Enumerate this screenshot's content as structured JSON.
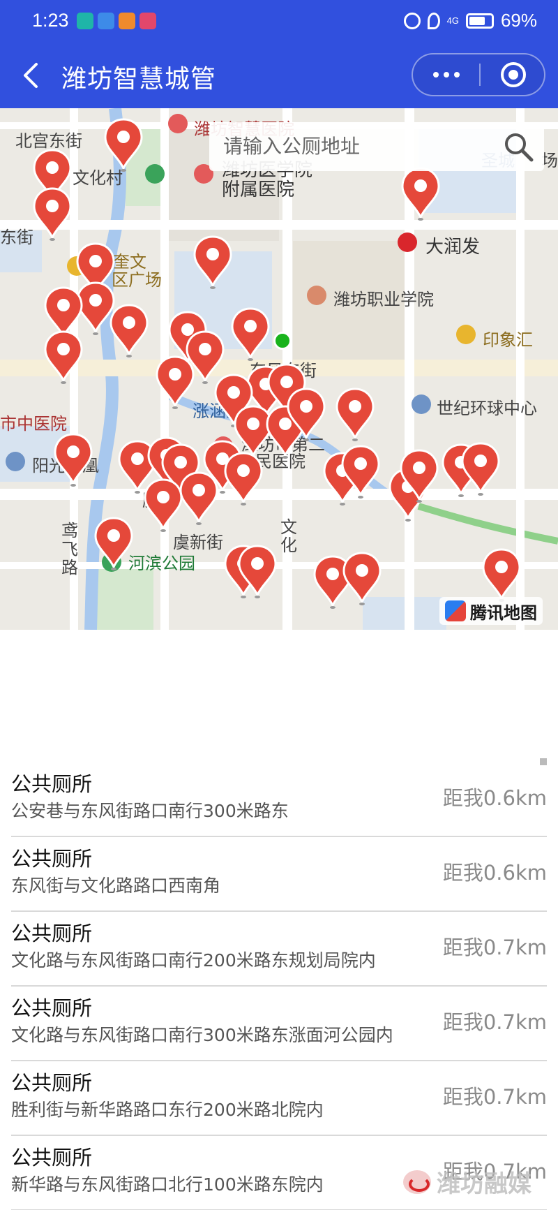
{
  "status_bar": {
    "time": "1:23",
    "battery": "69%",
    "network": "4G"
  },
  "header": {
    "title": "潍坊智慧城管"
  },
  "colors": {
    "header_bg": "#3150de",
    "pin_red": "#e5483a",
    "current_location": "#19b31c"
  },
  "search": {
    "placeholder": "请输入公厕地址"
  },
  "map": {
    "attribution": "腾讯地图",
    "labels": {
      "beigong": "北宫东街",
      "weifang_zhong": "潍坊智慧医院",
      "wenhuacun": "文化村",
      "yixueyuan1": "潍坊医学院",
      "yixueyuan2": "附属医院",
      "dongjie": "东街",
      "shengshi": "圣城",
      "chang": "场",
      "kuiwen1": "鸢奎文",
      "kuiwen2": "区广场",
      "darunfa": "大润发",
      "zhiye": "潍坊职业学院",
      "yinxianghui": "印象汇",
      "dongfeng": "东风东街",
      "guangchang": "广场",
      "zhangmianhe": "涨涵河",
      "shiji": "世纪环球中心",
      "zhongyiyuan": "市中医院",
      "renmin1": "潍坊市第二",
      "renmin2": "人民医院",
      "yangguang": "阳光凤凰",
      "sheng": "胜",
      "yuxin": "虞新街",
      "wenhua_road1": "文",
      "wenhua_road2": "化",
      "yuanfei1": "鸢",
      "yuanfei2": "飞",
      "yuanfei3": "路",
      "hebin": "河滨公园"
    }
  },
  "toilets": [
    {
      "name": "公共厕所",
      "address": "公安巷与东风街路口南行300米路东",
      "distance": "距我0.6km"
    },
    {
      "name": "公共厕所",
      "address": "东风街与文化路路口西南角",
      "distance": "距我0.6km"
    },
    {
      "name": "公共厕所",
      "address": "文化路与东风街路口南行200米路东规划局院内",
      "distance": "距我0.7km"
    },
    {
      "name": "公共厕所",
      "address": "文化路与东风街路口南行300米路东涨面河公园内",
      "distance": "距我0.7km"
    },
    {
      "name": "公共厕所",
      "address": "胜利街与新华路路口东行200米路北院内",
      "distance": "距我0.7km"
    },
    {
      "name": "公共厕所",
      "address": "新华路与东风街路口北行100米路东院内",
      "distance": "距我0.7km"
    }
  ],
  "watermark": "潍坊融媒"
}
